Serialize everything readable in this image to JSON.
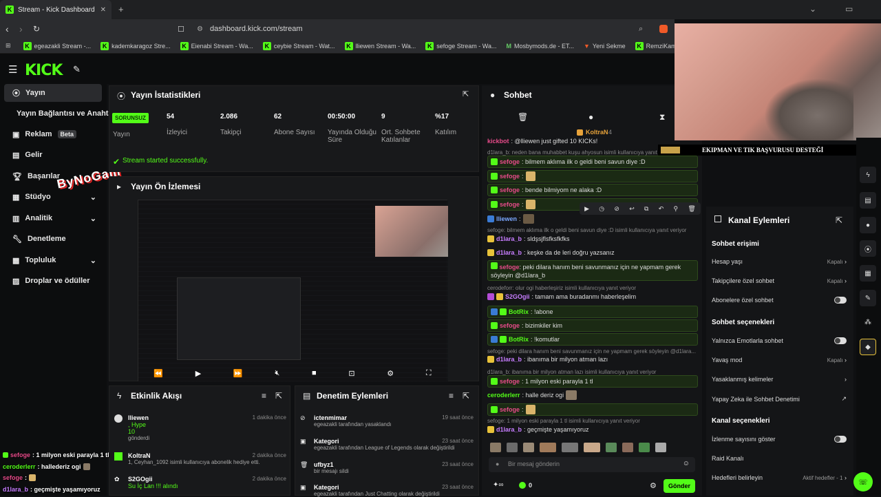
{
  "browser": {
    "tab_title": "Stream - Kick Dashboard",
    "url": "dashboard.kick.com/stream",
    "bookmarks": [
      "egeazakli Stream -...",
      "kademkaragoz Stre...",
      "Eienabi Stream - Wa...",
      "ceybie Stream - Wat...",
      "lliewen Stream - Wa...",
      "sefoge Stream - Wa...",
      "Mosbymods.de - ET...",
      "Yeni Sekme",
      "RemziKamalak Strea..."
    ]
  },
  "sidebar": {
    "items": [
      {
        "label": "Yayın"
      },
      {
        "label": "Yayın Bağlantısı ve Anahtarı"
      },
      {
        "label": "Reklam",
        "badge": "Beta"
      },
      {
        "label": "Gelir"
      },
      {
        "label": "Başarılar"
      },
      {
        "label": "Stüdyo"
      },
      {
        "label": "Analitik"
      },
      {
        "label": "Denetleme"
      },
      {
        "label": "Topluluk"
      },
      {
        "label": "Droplar ve ödüller"
      }
    ]
  },
  "watermark": "ByNoGam",
  "stats": {
    "title": "Yayın İstatistikleri",
    "status_badge": "SORUNSUZ",
    "status_label": "Yayın",
    "items": [
      {
        "value": "54",
        "label": "İzleyici"
      },
      {
        "value": "2.086",
        "label": "Takipçi"
      },
      {
        "value": "62",
        "label": "Abone Sayısı"
      },
      {
        "value": "00:50:00",
        "label": "Yayında Olduğu Süre"
      },
      {
        "value": "9",
        "label": "Ort. Sohbete Katılanlar"
      },
      {
        "value": "%17",
        "label": "Katılım"
      }
    ],
    "success_msg": "Stream started successfully."
  },
  "preview": {
    "title": "Yayın Ön İzlemesi"
  },
  "activity": {
    "title": "Etkinlik Akışı",
    "items": [
      {
        "name": "lliewen",
        "line1": ", Hype",
        "line2": "10",
        "line3": "gönderdi",
        "time": "1 dakika önce"
      },
      {
        "name": "KoltraN",
        "line1": "1, Ceyhan_1092 isimli kullanıcıya abonelik hediye etti.",
        "time": "2 dakika önce"
      },
      {
        "name": "S2GOgii",
        "line1": "Su İç Lan !!! alındı",
        "time": "2 dakika önce"
      }
    ]
  },
  "moderation": {
    "title": "Denetim Eylemleri",
    "items": [
      {
        "name": "ictenmimar",
        "line1": "egeazakli tarafından yasaklandı",
        "time": "19 saat önce"
      },
      {
        "name": "Kategori",
        "line1": "egeazakli tarafından League of Legends olarak değiştirildi",
        "time": "23 saat önce"
      },
      {
        "name": "ufbyz1",
        "line1": "bir mesajı sildi",
        "time": "23 saat önce"
      },
      {
        "name": "Kategori",
        "line1": "egeazakli tarafından Just Chatting olarak değiştirildi",
        "time": "23 saat önce"
      }
    ]
  },
  "chat": {
    "title": "Sohbet",
    "pinned_user": "KoltraN",
    "pinned_count": "4",
    "messages": [
      {
        "user": "kickbot",
        "text": ": @lliewen just gifted 10 KICKs!"
      },
      {
        "reply": "d1lara_b: neden bana muhabbet kuşu ahyosun isimli kullanıcıya yanıt veriyor"
      },
      {
        "user": "sefoge",
        "text": ": bilmem aklıma ilk o geldi beni savun diye :D"
      },
      {
        "user": "sefoge",
        "text": ":"
      },
      {
        "user": "sefoge",
        "text": ": bende bilmiyom ne alaka :D"
      },
      {
        "user": "sefoge",
        "text": ":"
      },
      {
        "user": "lliewen",
        "text": ":"
      },
      {
        "reply": "sefoge: bilmem aklıma ilk o geldi beni savun diye :D isimli kullanıcıya yanıt veriyor"
      },
      {
        "user": "d1lara_b",
        "text": ": sldşsjflsfksfkfks"
      },
      {
        "user": "d1lara_b",
        "text": ": keşke da de leri doğru yazsanız"
      },
      {
        "user": "sefoge",
        "text": ": peki dilara hanım beni savunmanız için ne yapmam gerek söyleyin @d1lara_b"
      },
      {
        "reply": "cerodeforr: olur ogi haberleşiriz isimli kullanıcıya yanıt veriyor"
      },
      {
        "user": "S2GOgii",
        "text": ": tamam ama buradanmı haberleşelim"
      },
      {
        "user": "BotRix",
        "text": ": !abone"
      },
      {
        "user": "sefoge",
        "text": ": bizimkiler kim"
      },
      {
        "user": "BotRix",
        "text": ": !komutlar"
      },
      {
        "reply": "sefoge: peki dilara hanım beni savunmanız için ne yapmam gerek söyleyin @d1lara..."
      },
      {
        "user": "d1lara_b",
        "text": ": ibanıma bir milyon atman lazı"
      },
      {
        "reply": "d1lara_b: ibanıma bir milyon atman lazı isimli kullanıcıya yanıt veriyor"
      },
      {
        "user": "sefoge",
        "text": ": 1 milyon eski parayla 1 tl"
      },
      {
        "user": "ceroderlerr",
        "text": ": halle deriz ogi"
      },
      {
        "user": "sefoge",
        "text": ":"
      },
      {
        "reply": "sefoge: 1 milyon eski parayla 1 tl isimli kullanıcıya yanıt veriyor"
      },
      {
        "user": "d1lara_b",
        "text": ": geçmişte yaşamıyoruz"
      }
    ],
    "input_placeholder": "Bir mesaj gönderin",
    "points": "0",
    "send_label": "Gönder"
  },
  "channel_actions": {
    "title": "Kanal Eylemleri",
    "sections": [
      {
        "heading": "Sohbet erişimi"
      },
      {
        "heading": "Sohbet seçenekleri"
      },
      {
        "heading": "Kanal seçenekleri"
      }
    ],
    "options": [
      {
        "label": "Hesap yaşı",
        "value": "Kapalı"
      },
      {
        "label": "Takipçilere özel sohbet",
        "value": "Kapalı"
      },
      {
        "label": "Abonelere özel sohbet",
        "value": ""
      },
      {
        "label": "Yalnızca Emotlarla sohbet",
        "value": ""
      },
      {
        "label": "Yavaş mod",
        "value": "Kapalı"
      },
      {
        "label": "Yasaklanmış kelimeler",
        "value": ""
      },
      {
        "label": "Yapay Zeka ile Sohbet Denetimi",
        "value": ""
      },
      {
        "label": "İzlenme sayısını göster",
        "value": ""
      },
      {
        "label": "Raid Kanalı",
        "value": ""
      },
      {
        "label": "Hedefleri belirleyin",
        "value": "Aktif hedefler - 1"
      }
    ]
  },
  "overlay": {
    "banner": "EKIPMAN VE TIK BAŞVURUSU DESTEĞİ",
    "chat": [
      {
        "user": "sefoge",
        "text": ": 1 milyon eski parayla 1 tl"
      },
      {
        "user": "ceroderlerr",
        "text": ": hallederiz ogi"
      },
      {
        "user": "sefoge",
        "text": ":"
      },
      {
        "user": "d1lara_b",
        "text": ": geçmişte yaşamıyoruz"
      }
    ]
  },
  "colors": {
    "accent": "#53fc18",
    "sefoge": "#e84b8a",
    "d1lara": "#c77dff",
    "botrix": "#53fc18",
    "lliewen": "#7aa7ff"
  }
}
